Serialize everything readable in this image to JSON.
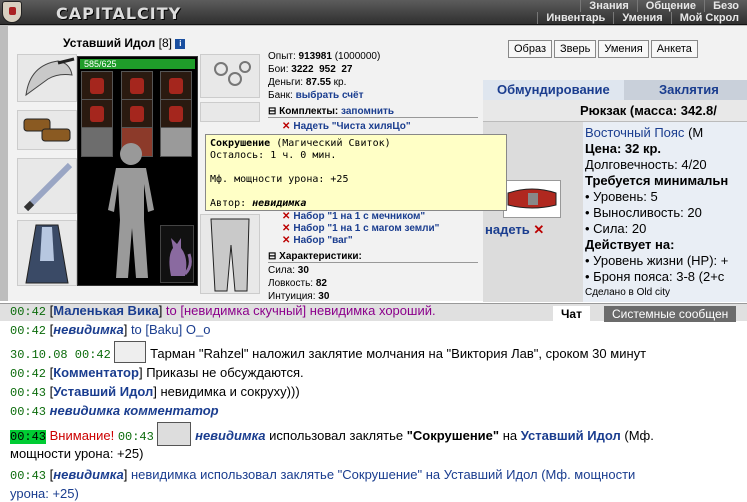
{
  "header": {
    "logo_text": "CAPITALCITY",
    "nav_row1": [
      "Знания",
      "Общение",
      "Безо"
    ],
    "nav_row2": [
      "Инвентарь",
      "Умения",
      "Мой Скрол"
    ]
  },
  "character": {
    "name": "Уставший Идол",
    "level": "[8]",
    "info_icon": "i",
    "hp": "585/625",
    "hp_fraction": 0.936
  },
  "stats": {
    "exp_label": "Опыт:",
    "exp_value": "913981",
    "exp_next": "(1000000)",
    "fights_label": "Бои:",
    "wins": "3222",
    "losses": "952",
    "draws": "27",
    "money_label": "Деньги:",
    "money_value": "87.55",
    "money_unit": "кр.",
    "bank_label": "Банк:",
    "bank_link": "выбрать счёт"
  },
  "buttons": [
    "Образ",
    "Зверь",
    "Умения",
    "Анкета"
  ],
  "kits": {
    "header": "Комплекты:",
    "remember": "запомнить",
    "items": [
      "Надеть \"Чиста хиляЦо\"",
      "Набор \"1 на 1 с мечником\"",
      "Набор \"1 на 1 с магом земли\"",
      "Набор \"ваг\""
    ]
  },
  "characteristics": {
    "header": "Характеристики:",
    "str": "Сила:",
    "str_v": "30",
    "dex": "Ловкость:",
    "dex_v": "82",
    "int": "Интуиция:",
    "int_v": "30"
  },
  "tooltip": {
    "title": "Сокрушение",
    "subtitle": "(Магический Свиток)",
    "left": "Осталось: 1 ч. 0 мин.",
    "effect": "Мф. мощности урона: +25",
    "author_label": "Автор:",
    "author": "невидимка"
  },
  "tabs": {
    "equip": "Обмундирование",
    "curse": "Заклятия"
  },
  "backpack": "Рюкзак (масса: 342.8/",
  "item": {
    "name": "Восточный Пояс",
    "name_suffix": "(М",
    "price": "Цена: 32 кр.",
    "durability": "Долговечность: 4/20",
    "requires": "Требуется минимальн",
    "req_level": "• Уровень: 5",
    "req_stam": "• Выносливость: 20",
    "req_str": "• Сила: 20",
    "acts": "Действует на:",
    "hp": "• Уровень жизни (HP): +",
    "armor": "• Броня пояса: 3-8 (2+с",
    "made": "Сделано в Old city",
    "wear": "надеть"
  },
  "chat_tabs": {
    "chat": "Чат",
    "system": "Системные сообщен"
  },
  "chat": [
    {
      "time": "00:42",
      "nick": "Маленькая Вика",
      "to": "to [невидимка скучный]",
      "text": "невидимка хороший."
    },
    {
      "time": "00:42",
      "nick": "невидимка",
      "to": "to [Baku]",
      "text": "O_o"
    },
    {
      "time": "30.10.08 00:42",
      "text": "Тарман \"Rahzel\" наложил заклятие молчания на \"Виктория Лав\", сроком 30 минут"
    },
    {
      "time": "00:42",
      "nick": "Комментатор",
      "text": "Приказы не обсуждаются."
    },
    {
      "time": "00:43",
      "nick": "Уставший Идол",
      "text": "невидимка и сокруху)))"
    },
    {
      "time": "00:43",
      "text": "невидимка комментатор"
    },
    {
      "time": "00:43",
      "warn": "Внимание!",
      "time2": "00:43",
      "actor": "невидимка",
      "text1": "использовал заклятье",
      "spell": "\"Сокрушение\"",
      "on": "на",
      "target": "Уставший Идол",
      "tail1": "(Мф.",
      "tail2": "мощности урона: +25)"
    },
    {
      "time": "00:43",
      "nick": "невидимка",
      "text": "невидимка использовал заклятье \"Сокрушение\" на Уставший Идол (Мф. мощности",
      "text2": "урона: +25)"
    }
  ]
}
